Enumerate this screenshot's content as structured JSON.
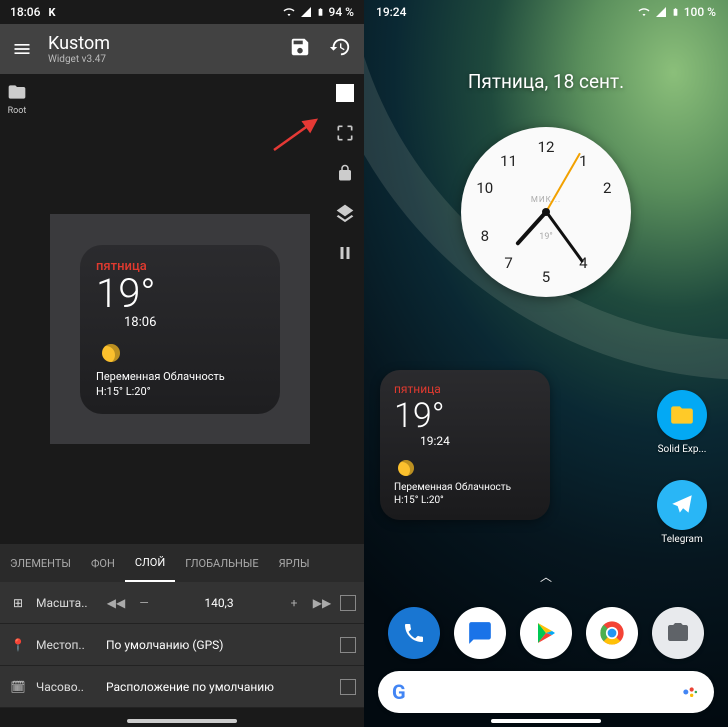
{
  "left": {
    "statusbar": {
      "time": "18:06",
      "k_badge": "K",
      "battery": "94 %"
    },
    "appbar": {
      "title": "Kustom",
      "subtitle": "Widget v3.47"
    },
    "left_rail": {
      "label": "Root"
    },
    "right_rail_icons": [
      "square",
      "fullscreen",
      "lock",
      "layers",
      "pause"
    ],
    "widget": {
      "day": "пятница",
      "temp": "19°",
      "time": "18:06",
      "condition": "Переменная Облачность",
      "highlow": "H:15° L:20°"
    },
    "tabs": [
      "ЭЛЕМЕНТЫ",
      "ФОН",
      "СЛОЙ",
      "ГЛОБАЛЬНЫЕ",
      "ЯРЛЫ"
    ],
    "active_tab": 2,
    "props": {
      "scale": {
        "label": "Масшта..",
        "value": "140,3"
      },
      "location": {
        "label": "Местоп..",
        "value": "По умолчанию (GPS)"
      },
      "tz": {
        "label": "Часово..",
        "value": "Расположение по умолчанию"
      }
    }
  },
  "right": {
    "statusbar": {
      "time": "19:24",
      "battery": "100 %"
    },
    "date": "Пятница, 18 сент.",
    "clock": {
      "numbers": [
        "12",
        "1",
        "2",
        "4",
        "5",
        "7",
        "8",
        "10",
        "11"
      ],
      "brand": "МИК...",
      "temp": "19°"
    },
    "widget": {
      "day": "пятница",
      "temp": "19°",
      "time": "19:24",
      "condition": "Переменная Облачность",
      "highlow": "H:15° L:20°"
    },
    "apps": {
      "solid": "Solid Exp...",
      "telegram": "Telegram"
    },
    "search_letter": "G"
  }
}
